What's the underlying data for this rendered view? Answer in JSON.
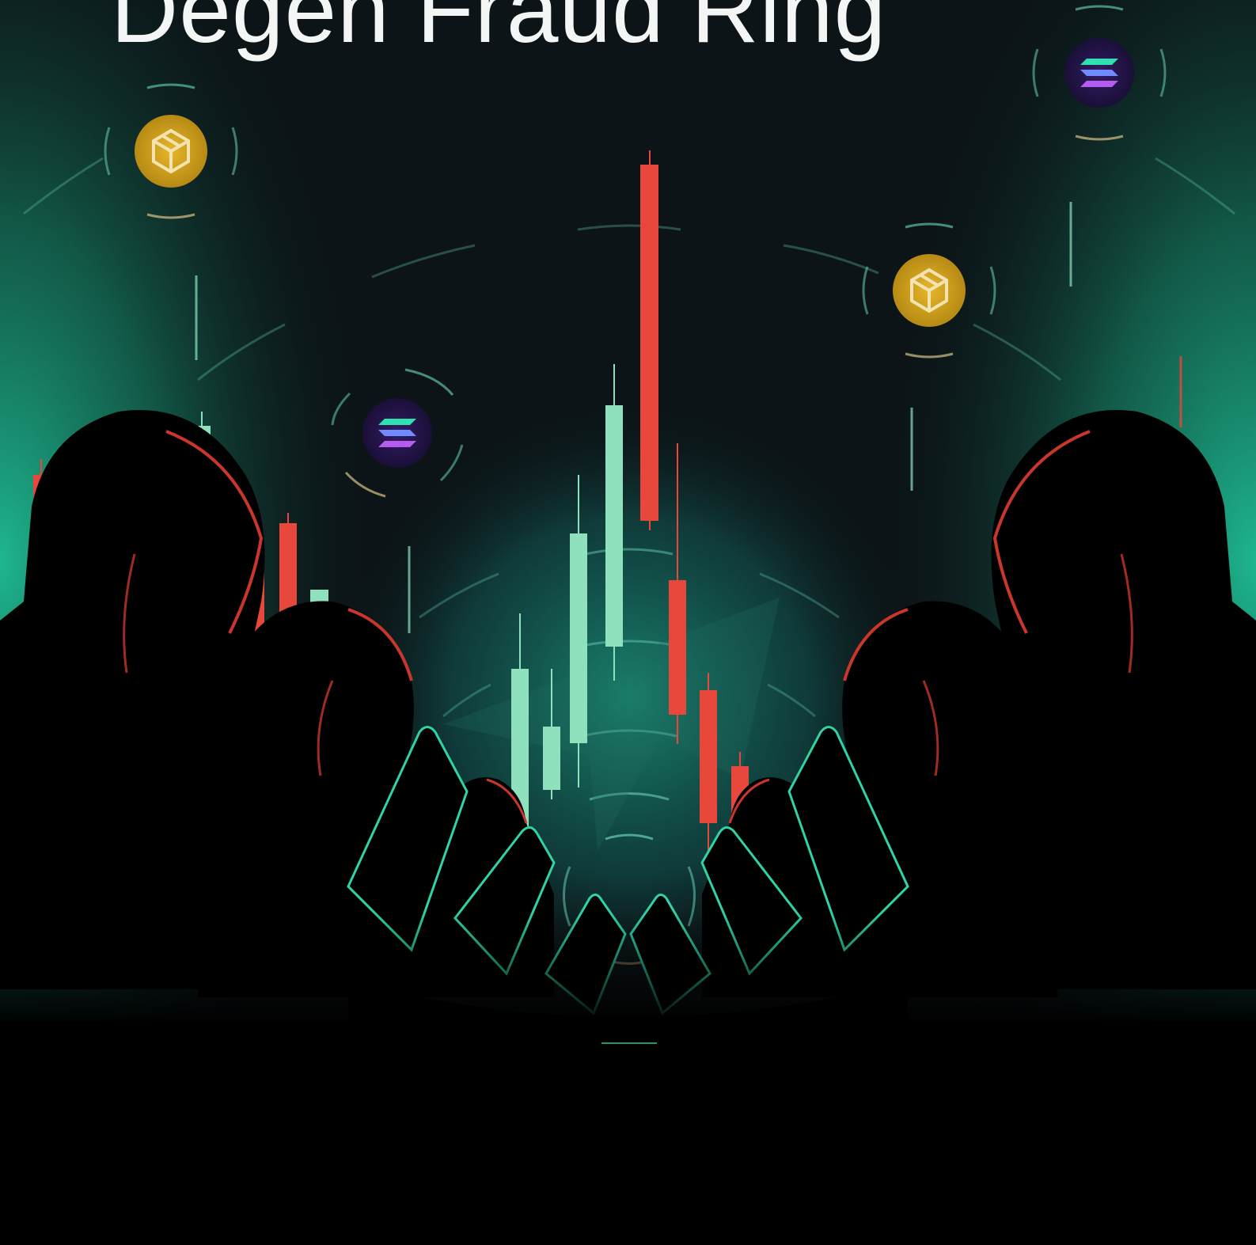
{
  "poster": {
    "title": "Degen Fraud Ring"
  },
  "colors": {
    "background": "#0c1417",
    "teal_glow": "#1fbf95",
    "bull_candle": "#8fe0bd",
    "bear_candle": "#e8473b",
    "hood_rim": "#c9362c",
    "coin_gold": "#d4a520",
    "coin_purple": "#2a1650",
    "silhouette": "#000000",
    "title_text": "#f4f6f5"
  },
  "illustration": {
    "coins": [
      {
        "name": "bnb-coin",
        "icon": "bnb-icon"
      },
      {
        "name": "bnb-coin",
        "icon": "bnb-icon"
      },
      {
        "name": "solana-coin",
        "icon": "solana-icon"
      },
      {
        "name": "solana-coin",
        "icon": "solana-icon"
      }
    ],
    "figures": [
      "hooded-figure",
      "hooded-figure",
      "hooded-figure",
      "hooded-figure",
      "hooded-figure",
      "hooded-figure"
    ],
    "center_emblem": "telegram-logo-icon"
  }
}
